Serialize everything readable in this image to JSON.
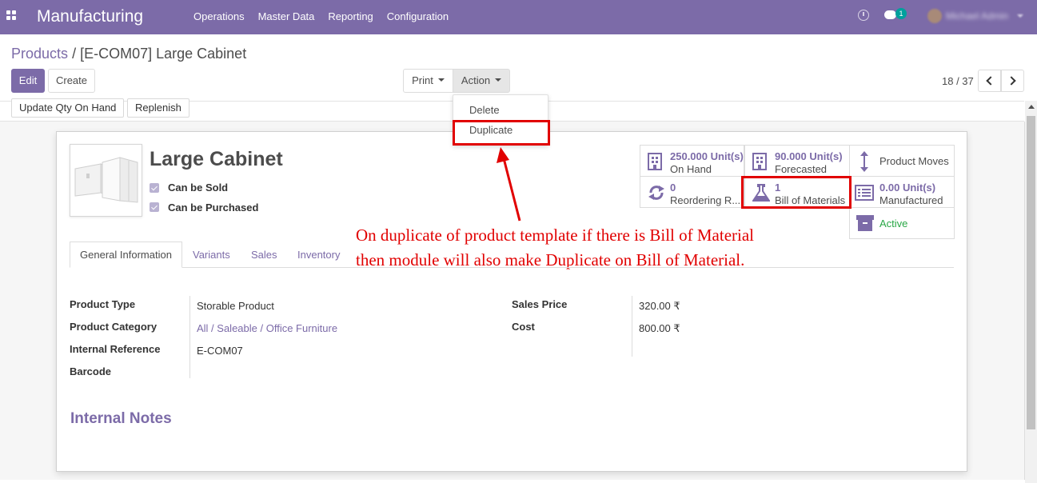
{
  "app": {
    "name": "Manufacturing",
    "menu": [
      "Operations",
      "Master Data",
      "Reporting",
      "Configuration"
    ],
    "chat_count": "1"
  },
  "breadcrumb": {
    "parent": "Products",
    "separator": "/",
    "current": "[E-COM07] Large Cabinet"
  },
  "buttons": {
    "edit": "Edit",
    "create": "Create",
    "print": "Print",
    "action": "Action"
  },
  "action_menu": {
    "items": [
      "Delete",
      "Duplicate"
    ]
  },
  "pager": {
    "text": "18 / 37"
  },
  "statusbar": {
    "update_qty": "Update Qty On Hand",
    "replenish": "Replenish"
  },
  "product": {
    "name": "Large Cabinet",
    "can_be_sold": "Can be Sold",
    "can_be_purchased": "Can be Purchased"
  },
  "smart_buttons": {
    "on_hand": {
      "value": "250.000",
      "unit": "Unit(s)",
      "label": "On Hand"
    },
    "forecasted": {
      "value": "90.000",
      "unit": "Unit(s)",
      "label": "Forecasted"
    },
    "product_moves": {
      "label": "Product Moves"
    },
    "reordering": {
      "value": "0",
      "label": "Reordering R..."
    },
    "bom": {
      "value": "1",
      "label": "Bill of Materials"
    },
    "manufactured": {
      "value": "0.00",
      "unit": "Unit(s)",
      "label": "Manufactured"
    },
    "active": {
      "label": "Active"
    }
  },
  "annotation": {
    "line1": "On duplicate of product template if there is Bill of Material",
    "line2": "then module will also make Duplicate on Bill of Material."
  },
  "tabs": [
    "General Information",
    "Variants",
    "Sales",
    "Inventory"
  ],
  "fields": {
    "product_type": {
      "label": "Product Type",
      "value": "Storable Product"
    },
    "product_category": {
      "label": "Product Category",
      "value": "All / Saleable / Office Furniture"
    },
    "internal_reference": {
      "label": "Internal Reference",
      "value": "E-COM07"
    },
    "barcode": {
      "label": "Barcode",
      "value": ""
    },
    "sales_price": {
      "label": "Sales Price",
      "value": "320.00 ₹"
    },
    "cost": {
      "label": "Cost",
      "value": "800.00 ₹"
    }
  },
  "internal_notes": {
    "title": "Internal Notes"
  },
  "colors": {
    "brand": "#7c6ba8",
    "highlight": "#e10000",
    "active_green": "#28a745"
  }
}
